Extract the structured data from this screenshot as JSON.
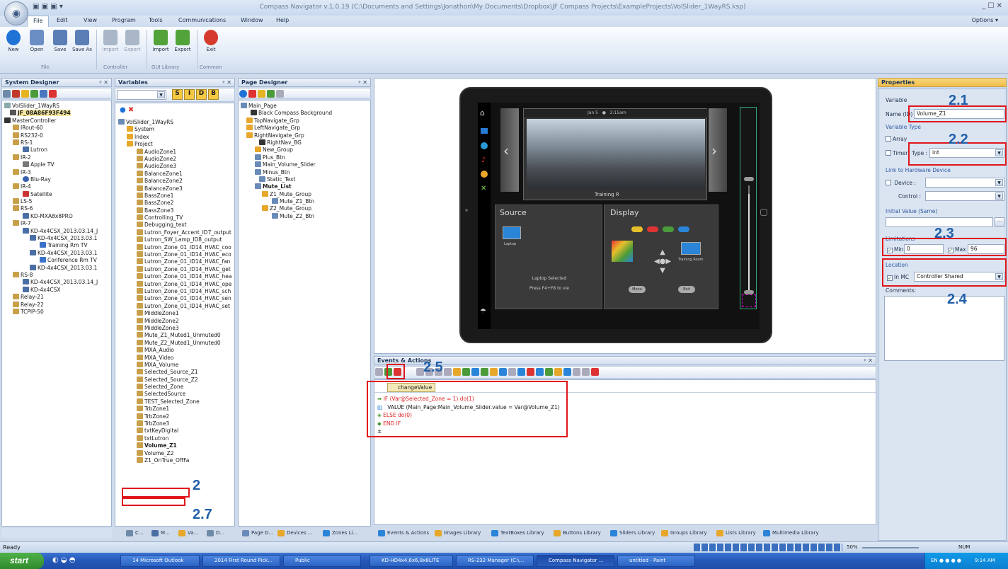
{
  "window": {
    "title": "Compass Navigator  v.1.0.19 (C:\\Documents and Settings\\Jonathon\\My Documents\\Dropbox\\JF Compass Projects\\ExampleProjects\\VolSlider_1WayRS.ksp)",
    "controls": "_ ☐ ✕"
  },
  "menu": {
    "items": [
      "File",
      "Edit",
      "View",
      "Program",
      "Tools",
      "Communications",
      "Window",
      "Help"
    ],
    "options": "Options ▾"
  },
  "ribbon": {
    "buttons": [
      {
        "label": "New",
        "color": "#1f73d6"
      },
      {
        "label": "Open",
        "color": "#6b8fc4"
      },
      {
        "label": "Save",
        "color": "#5a7fb7"
      },
      {
        "label": "Save As",
        "color": "#5a7fb7"
      },
      {
        "label": "Import",
        "color": "#a9b7c9"
      },
      {
        "label": "Export",
        "color": "#a9b7c9"
      },
      {
        "label": "Import",
        "color": "#52a33a"
      },
      {
        "label": "Export",
        "color": "#52a33a"
      },
      {
        "label": "Exit",
        "color": "#d53b2d"
      }
    ],
    "groups": [
      "File",
      "Controller",
      "GUI Library",
      "Common"
    ]
  },
  "system_designer": {
    "title": "System Designer",
    "items": [
      "VolSlider_1WayRS",
      "JF_08A86F93F494",
      "MasterController",
      "IRout-60",
      "RS232-0",
      "RS-1",
      "Lutron",
      "IR-2",
      "Apple TV",
      "IR-3",
      "Blu-Ray",
      "IR-4",
      "Satellite",
      "LS-5",
      "RS-6",
      "KD-MXA8x8PRO",
      "IR-7",
      "KD-4x4CSX_2013.03.14_J",
      "KD-4x4CSX_2013.03.1",
      "Training Rm TV",
      "KD-4x4CSX_2013.03.1",
      "Conference Rm TV",
      "KD-4x4CSX_2013.03.1",
      "RS-8",
      "KD-4x4CSX_2013.03.14_J",
      "KD-4x4CSX",
      "Relay-21",
      "Relay-22",
      "TCPIP-50"
    ]
  },
  "variables": {
    "title": "Variables",
    "type_buttons": [
      "S",
      "I",
      "D",
      "B"
    ],
    "items": [
      "VolSlider_1WayRS",
      "System",
      "Index",
      "Project",
      "AudioZone1",
      "AudioZone2",
      "AudioZone3",
      "BalanceZone1",
      "BalanceZone2",
      "BalanceZone3",
      "BassZone1",
      "BassZone2",
      "BassZone3",
      "Controlling_TV",
      "Debugging_text",
      "Lutron_Foyer_Accent_ID7_output",
      "Lutron_SW_Lamp_ID8_output",
      "Lutron_Zone_01_ID14_HVAC_coo",
      "Lutron_Zone_01_ID14_HVAC_eco",
      "Lutron_Zone_01_ID14_HVAC_fan",
      "Lutron_Zone_01_ID14_HVAC_get",
      "Lutron_Zone_01_ID14_HVAC_hea",
      "Lutron_Zone_01_ID14_HVAC_ope",
      "Lutron_Zone_01_ID14_HVAC_sch",
      "Lutron_Zone_01_ID14_HVAC_sen",
      "Lutron_Zone_01_ID14_HVAC_set",
      "MiddleZone1",
      "MiddleZone2",
      "MiddleZone3",
      "Mute_Z1_Muted1_Unmuted0",
      "Mute_Z2_Muted1_Unmuted0",
      "MXA_Audio",
      "MXA_Video",
      "MXA_Volume",
      "Selected_Source_Z1",
      "Selected_Source_Z2",
      "Selected_Zone",
      "SelectedSource",
      "TEST_Selected_Zone",
      "TrbZone1",
      "TrbZone2",
      "TrbZone3",
      "txtKeyDigital",
      "txtLutron",
      "Volume_Z1",
      "Volume_Z2",
      "Z1_OnTrue_OffFa"
    ]
  },
  "page_designer": {
    "title": "Page Designer",
    "items": [
      "Main_Page",
      "Black Compass Background",
      "TopNavigate_Grp",
      "LeftNavigate_Grp",
      "RightNavigate_Grp",
      "RightNav_BG",
      "New_Group",
      "Plus_Btn",
      "Main_Volume_Slider",
      "Minus_Btn",
      "Static_Text",
      "Mute_List",
      "Z1_Mute_Group",
      "Mute_Z1_Btn",
      "Z2_Mute_Group",
      "Mute_Z2_Btn"
    ]
  },
  "left_tabs": [
    "C...",
    "M...",
    "Va...",
    "D..."
  ],
  "page_tabs": [
    "Page D...",
    "Devices ...",
    "Zones Li..."
  ],
  "device": {
    "top_label_1": "Jan 5",
    "top_label_2": "2:15am",
    "room_label": "Training R",
    "source_title": "Source",
    "display_title": "Display",
    "laptop_label": "Laptop",
    "selected_text": "Laptop Selected",
    "hint_text": "Press F4+F8 to vie",
    "training_room": "Training Room",
    "menu_btn": "Menu",
    "exit_btn": "Exit",
    "slider_level": 0.92
  },
  "events": {
    "title": "Events & Actions",
    "tab": "changeValue",
    "lines": [
      "IF (Var@Selected_Zone = 1) do(1)",
      "VALUE  (Main_Page:Main_Volume_Slider.value = Var@Volume_Z1)",
      "ELSE do(0)",
      "END IF"
    ]
  },
  "bottom_tabs": [
    "Events & Actions",
    "Images Library",
    "TextBoxes Library",
    "Buttons Library",
    "Sliders Library",
    "Groups Library",
    "Lists Library",
    "Multimedia Library"
  ],
  "properties": {
    "title": "Properties",
    "variable_label": "Variable",
    "name_label": "Name (ID)",
    "name_value": "Volume_Z1",
    "variable_type": "Variable Type",
    "array_label": "Array",
    "timer_label": "Timer",
    "type_label": "Type :",
    "type_value": "int",
    "link_label": "Link to Hardware Device",
    "device_label": "Device :",
    "control_label": "Control :",
    "initial_label": "Initial Value (Same)",
    "limitations": "Limitations",
    "min_label": "Min",
    "min_value": "0",
    "max_label": "Max",
    "max_value": "96",
    "location": "Location",
    "in_mc_label": "In MC",
    "location_value": "Controller Shared",
    "comments_label": "Comments:"
  },
  "callouts": [
    "2.1",
    "2.2",
    "2.3",
    "2.4",
    "2.5",
    "2",
    "2.7"
  ],
  "status": {
    "ready": "Ready",
    "zoom": "50%",
    "num": "NUM"
  },
  "taskbar": {
    "start": "start",
    "tasks": [
      "14 Microsoft Outlook",
      "2014 First Round Pick...",
      "Public",
      "KD-HD4x4,6x6,8x8LITE",
      "RS-232 Manager (C:\\...",
      "Compass Navigator ...",
      "untitled - Paint"
    ],
    "clock": "9:14 AM",
    "lang": "EN"
  },
  "colors": {
    "accent": "#1f5fa8",
    "highlight_red": "#e0151b",
    "ribbon_bg": "#dfe8f5",
    "taskbar": "#2457b8"
  }
}
